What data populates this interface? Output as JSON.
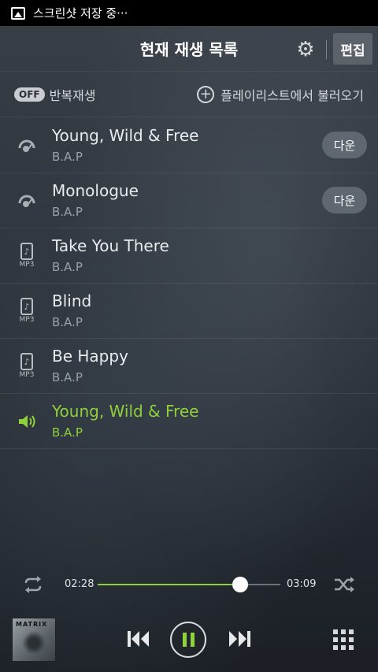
{
  "status_bar": {
    "text": "스크린샷 저장 중···",
    "icon": "image-icon"
  },
  "header": {
    "title": "현재 재생 목록",
    "settings_icon": "gear-icon",
    "edit_label": "편집"
  },
  "toolbar": {
    "repeat_state": "OFF",
    "repeat_label": "반복재생",
    "load_label": "플레이리스트에서 불러오기",
    "load_icon": "plus-circle-icon"
  },
  "playlist": {
    "accent_color": "#8fd13a",
    "items": [
      {
        "title": "Young, Wild & Free",
        "artist": "B.A.P",
        "icon": "streaming-icon",
        "download_label": "다운"
      },
      {
        "title": "Monologue",
        "artist": "B.A.P",
        "icon": "streaming-icon",
        "download_label": "다운"
      },
      {
        "title": "Take You There",
        "artist": "B.A.P",
        "icon": "mp3-icon",
        "mp3_label": "MP3"
      },
      {
        "title": "Blind",
        "artist": "B.A.P",
        "icon": "mp3-icon",
        "mp3_label": "MP3"
      },
      {
        "title": "Be Happy",
        "artist": "B.A.P",
        "icon": "mp3-icon",
        "mp3_label": "MP3"
      },
      {
        "title": "Young, Wild & Free",
        "artist": "B.A.P",
        "icon": "speaker-icon",
        "playing": true
      }
    ]
  },
  "player": {
    "current_time": "02:28",
    "total_time": "03:09",
    "progress": 0.78,
    "album_text": "MATRIX",
    "state": "playing"
  }
}
